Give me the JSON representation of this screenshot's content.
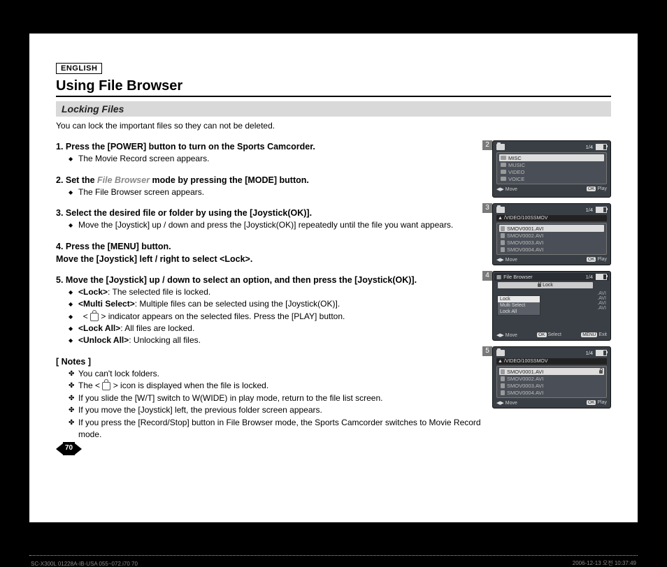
{
  "lang": "ENGLISH",
  "title": "Using File Browser",
  "section": "Locking Files",
  "intro": "You can lock the important files so they can not be deleted.",
  "steps": {
    "s1": {
      "head": "1.  Press the [POWER] button to turn on the Sports Camcorder.",
      "sub1": "The Movie Record screen appears."
    },
    "s2": {
      "head_a": "2.  Set the ",
      "head_grey": "File Browser",
      "head_b": " mode by pressing the [MODE] button.",
      "sub1": "The File Browser screen appears."
    },
    "s3": {
      "head": "3.  Select the desired file or folder by using the [Joystick(OK)].",
      "sub1": "Move the [Joystick] up / down and press the [Joystick(OK)] repeatedly until the file you want appears."
    },
    "s4": {
      "head_a": "4.  Press the [MENU] button.",
      "head_b": "Move the [Joystick] left / right to select <Lock>."
    },
    "s5": {
      "head": "5.  Move the [Joystick] up / down to select an option, and then press the [Joystick(OK)].",
      "sub1_a": "<Lock>",
      "sub1_b": ": The selected file is locked.",
      "sub2_a": "<Multi Select>",
      "sub2_b": ": Multiple files can be selected using the [Joystick(OK)].",
      "sub2_c": "< ",
      "sub2_d": " > indicator appears on the selected files. Press the [PLAY] button.",
      "sub3_a": "<Lock All>",
      "sub3_b": ": All files are locked.",
      "sub4_a": "<Unlock All>",
      "sub4_b": ": Unlocking all files."
    }
  },
  "notes_head": "[ Notes ]",
  "notes": {
    "n1": "You can't lock folders.",
    "n2_a": "The < ",
    "n2_b": " > icon is displayed when the file is locked.",
    "n3": "If you slide the [W/T] switch to W(WIDE) in play mode, return to the file list screen.",
    "n4": "If you move the [Joystick] left, the previous folder screen appears.",
    "n5": "If you press the [Record/Stop] button in File Browser mode, the Sports Camcorder switches to Movie Record mode."
  },
  "page_num": "70",
  "screens": {
    "sc2": {
      "badge": "2",
      "counter": "1/4",
      "rows": [
        "MISC",
        "MUSIC",
        "VIDEO",
        "VOICE"
      ],
      "move": "Move",
      "play": "Play",
      "ok": "OK"
    },
    "sc3": {
      "badge": "3",
      "counter": "1/4",
      "path": "/VIDEO/100SSMOV",
      "rows": [
        "SMOV0001.AVI",
        "SMOV0002.AVI",
        "SMOV0003.AVI",
        "SMOV0004.AVI"
      ],
      "move": "Move",
      "play": "Play",
      "ok": "OK"
    },
    "sc4": {
      "badge": "4",
      "title": "File Browser",
      "counter": "1/4",
      "lock_tab": "Lock",
      "items": [
        "Lock",
        "Multi Select",
        "Lock All"
      ],
      "side_rows": [
        ".AVI",
        ".AVI",
        ".AVI",
        ".AVI"
      ],
      "move": "Move",
      "select": "Select",
      "exit": "Exit",
      "ok": "OK",
      "menu": "MENU"
    },
    "sc5": {
      "badge": "5",
      "counter": "1/4",
      "path": "/VIDEO/100SSMOV",
      "rows": [
        "SMOV0001.AVI",
        "SMOV0002.AVI",
        "SMOV0003.AVI",
        "SMOV0004.AVI"
      ],
      "move": "Move",
      "play": "Play",
      "ok": "OK"
    }
  },
  "footer": {
    "left": "SC-X300L 01228A-IB-USA 055~072.i70   70",
    "right": "2006-12-13   오전 10:37:49"
  }
}
